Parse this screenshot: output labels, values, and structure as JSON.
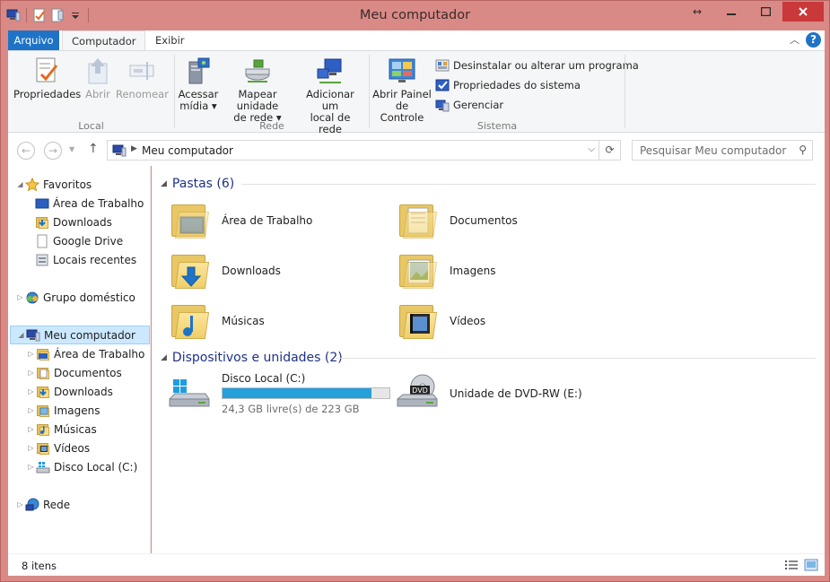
{
  "window": {
    "title": "Meu computador"
  },
  "tabs": {
    "file": "Arquivo",
    "computer": "Computador",
    "view": "Exibir"
  },
  "ribbon": {
    "local": {
      "label": "Local",
      "properties": "Propriedades",
      "open": "Abrir",
      "rename": "Renomear"
    },
    "network": {
      "label": "Rede",
      "access_media_1": "Acessar",
      "access_media_2": "mídia",
      "map_drive_1": "Mapear unidade",
      "map_drive_2": "de rede",
      "add_location_1": "Adicionar um",
      "add_location_2": "local de rede"
    },
    "system": {
      "label": "Sistema",
      "control_panel_1": "Abrir Painel",
      "control_panel_2": "de Controle",
      "uninstall": "Desinstalar ou alterar um programa",
      "system_properties": "Propriedades do sistema",
      "manage": "Gerenciar"
    }
  },
  "address": {
    "crumb": "Meu computador",
    "search_placeholder": "Pesquisar Meu computador"
  },
  "nav": {
    "favorites": "Favoritos",
    "fav_items": [
      "Área de Trabalho",
      "Downloads",
      "Google Drive",
      "Locais recentes"
    ],
    "homegroup": "Grupo doméstico",
    "computer": "Meu computador",
    "computer_items": [
      "Área de Trabalho",
      "Documentos",
      "Downloads",
      "Imagens",
      "Músicas",
      "Vídeos",
      "Disco Local (C:)"
    ],
    "network": "Rede"
  },
  "content": {
    "folders_header": "Pastas (6)",
    "folders": [
      "Área de Trabalho",
      "Documentos",
      "Downloads",
      "Imagens",
      "Músicas",
      "Vídeos"
    ],
    "devices_header": "Dispositivos e unidades (2)",
    "drive_c": {
      "name": "Disco Local (C:)",
      "free": "24,3 GB livre(s) de 223 GB",
      "used_fraction": 0.891
    },
    "drive_dvd": {
      "name": "Unidade de DVD-RW (E:)",
      "badge": "DVD"
    }
  },
  "status": {
    "count": "8 itens"
  },
  "colors": {
    "accent": "#1e73c6",
    "titlebar": "#d98a86",
    "close": "#c9383a",
    "usage_bar": "#26a0da",
    "section_header": "#1e3287"
  }
}
